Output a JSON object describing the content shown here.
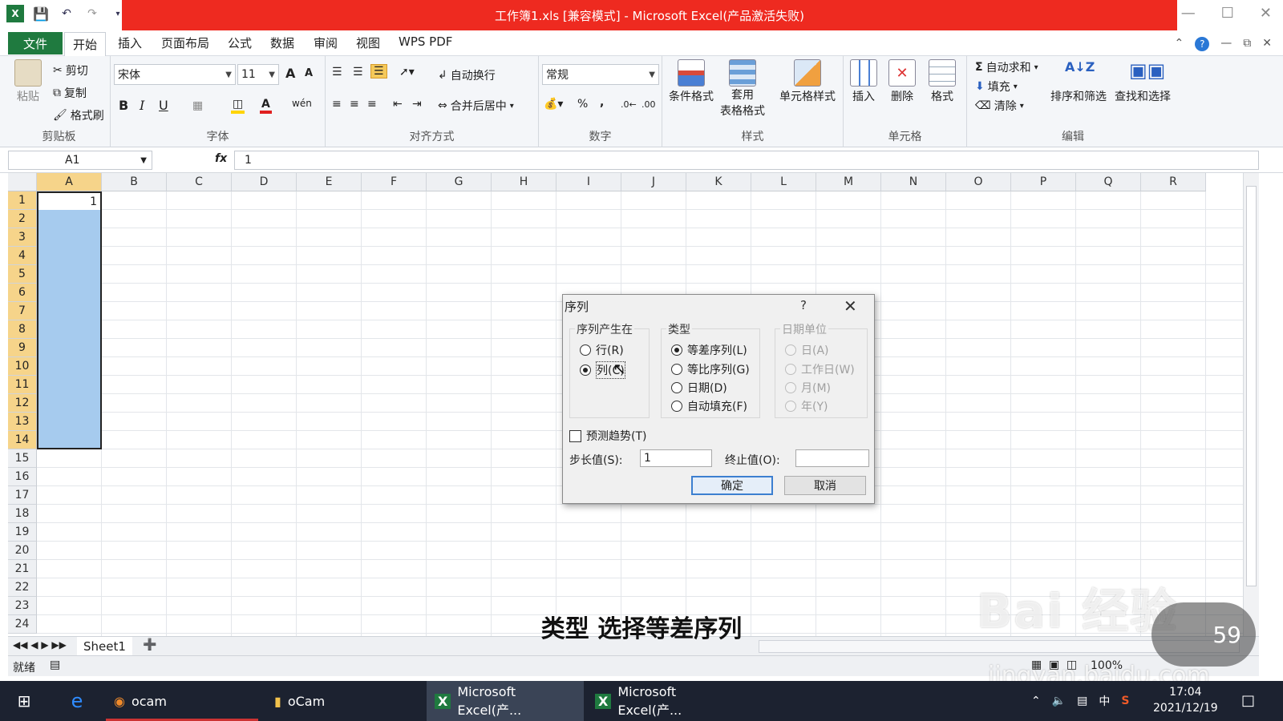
{
  "window": {
    "title": "工作簿1.xls  [兼容模式] - Microsoft Excel(产品激活失败)",
    "minimize_icon": "minimize-icon",
    "maximize_icon": "maximize-icon",
    "close_icon": "close-icon"
  },
  "menu": {
    "file": "文件",
    "tabs": [
      "开始",
      "插入",
      "页面布局",
      "公式",
      "数据",
      "审阅",
      "视图",
      "WPS PDF"
    ]
  },
  "ribbon": {
    "clipboard": {
      "paste": "粘贴",
      "cut": "剪切",
      "copy": "复制",
      "format_painter": "格式刷",
      "label": "剪贴板"
    },
    "font": {
      "name": "宋体",
      "size": "11",
      "bold": "B",
      "italic": "I",
      "underline": "U",
      "grow": "A",
      "shrink": "A",
      "label": "字体"
    },
    "alignment": {
      "wrap": "自动换行",
      "merge": "合并后居中",
      "label": "对齐方式"
    },
    "number": {
      "format": "常规",
      "percent": "%",
      "comma": ",",
      "label": "数字"
    },
    "styles": {
      "conditional": "条件格式",
      "table_line1": "套用",
      "table_line2": "表格格式",
      "cell_styles": "单元格样式",
      "label": "样式"
    },
    "cells": {
      "insert": "插入",
      "delete": "删除",
      "format": "格式",
      "label": "单元格"
    },
    "editing": {
      "autosum": "自动求和",
      "fill": "填充",
      "clear": "清除",
      "sort": "排序和筛选",
      "find": "查找和选择",
      "label": "编辑"
    }
  },
  "formula_bar": {
    "cell_ref": "A1",
    "fx": "fx",
    "value": "1"
  },
  "sheet": {
    "columns": [
      "A",
      "B",
      "C",
      "D",
      "E",
      "F",
      "G",
      "H",
      "I",
      "J",
      "K",
      "L",
      "M",
      "N",
      "O",
      "P",
      "Q",
      "R"
    ],
    "rows": [
      "1",
      "2",
      "3",
      "4",
      "5",
      "6",
      "7",
      "8",
      "9",
      "10",
      "11",
      "12",
      "13",
      "14",
      "15",
      "16",
      "17",
      "18",
      "19",
      "20",
      "21",
      "22",
      "23",
      "24"
    ],
    "a1_value": "1",
    "tab": "Sheet1"
  },
  "status": {
    "ready": "就绪",
    "zoom": "100%"
  },
  "dialog": {
    "title": "序列",
    "help": "?",
    "series_in": {
      "legend": "序列产生在",
      "rows": "行(R)",
      "columns": "列(C)",
      "selected": "columns"
    },
    "type": {
      "legend": "类型",
      "linear": "等差序列(L)",
      "growth": "等比序列(G)",
      "date": "日期(D)",
      "autofill": "自动填充(F)",
      "selected": "linear"
    },
    "date_unit": {
      "legend": "日期单位",
      "day": "日(A)",
      "weekday": "工作日(W)",
      "month": "月(M)",
      "year": "年(Y)"
    },
    "trend": "预测趋势(T)",
    "step_label": "步长值(S):",
    "step_value": "1",
    "stop_label": "终止值(O):",
    "stop_value": "",
    "ok": "确定",
    "cancel": "取消"
  },
  "caption": "类型 选择等差序列",
  "watermark": {
    "brand": "Bai 经验",
    "url": "jingyan.baidu.com",
    "timer": "59"
  },
  "taskbar": {
    "apps": [
      "ocam",
      "oCam",
      "Microsoft Excel(产...",
      "Microsoft Excel(产..."
    ],
    "ime": "中",
    "time": "17:04",
    "date": "2021/12/19"
  }
}
